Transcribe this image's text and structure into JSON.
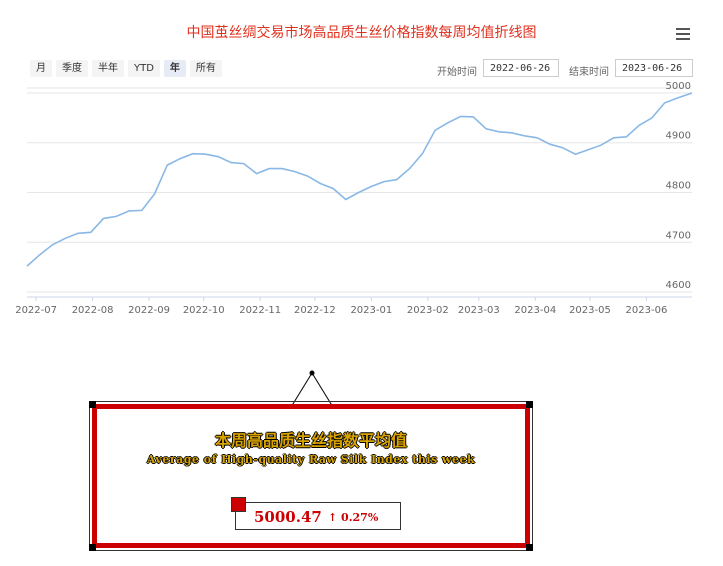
{
  "title": "中国茧丝绸交易市场高品质生丝价格指数每周均值折线图",
  "range_buttons": [
    "月",
    "季度",
    "半年",
    "YTD",
    "年",
    "所有"
  ],
  "active_range": "年",
  "start_label": "开始时间",
  "start_value": "2022-06-26",
  "end_label": "结束时间",
  "end_value": "2023-06-26",
  "summary": {
    "title": "本周高品质生丝指数平均值",
    "subtitle": "Average of High-quality Raw Silk Index this week",
    "value": "5000.47",
    "change": "↑ 0.27%"
  },
  "colors": {
    "line": "#8ab8e6",
    "accent": "#cc0000",
    "title": "#e0301e"
  },
  "chart_data": {
    "type": "line",
    "title": "中国茧丝绸交易市场高品质生丝价格指数每周均值折线图",
    "xlabel": "",
    "ylabel": "",
    "x_ticks": [
      "2022-07",
      "2022-08",
      "2022-09",
      "2022-10",
      "2022-11",
      "2022-12",
      "2023-01",
      "2023-02",
      "2023-03",
      "2023-04",
      "2023-05",
      "2023-06"
    ],
    "y_ticks": [
      4600,
      4700,
      4800,
      4900,
      5000
    ],
    "ylim": [
      4590,
      5010
    ],
    "xlim": [
      "2022-06-26",
      "2023-06-26"
    ],
    "grid": true,
    "series": [
      {
        "x": [
          "2022-06-26",
          "2022-07-03",
          "2022-07-10",
          "2022-07-17",
          "2022-07-24",
          "2022-07-31",
          "2022-08-07",
          "2022-08-14",
          "2022-08-21",
          "2022-08-28",
          "2022-09-04",
          "2022-09-11",
          "2022-09-18",
          "2022-09-25",
          "2022-10-02",
          "2022-10-09",
          "2022-10-16",
          "2022-10-23",
          "2022-10-30",
          "2022-11-06",
          "2022-11-13",
          "2022-11-20",
          "2022-11-27",
          "2022-12-04",
          "2022-12-11",
          "2022-12-18",
          "2022-12-25",
          "2023-01-01",
          "2023-01-08",
          "2023-01-15",
          "2023-01-22",
          "2023-01-29",
          "2023-02-05",
          "2023-02-12",
          "2023-02-19",
          "2023-02-26",
          "2023-03-05",
          "2023-03-12",
          "2023-03-19",
          "2023-03-26",
          "2023-04-02",
          "2023-04-09",
          "2023-04-16",
          "2023-04-23",
          "2023-04-30",
          "2023-05-07",
          "2023-05-14",
          "2023-05-21",
          "2023-05-28",
          "2023-06-04",
          "2023-06-11",
          "2023-06-18",
          "2023-06-26"
        ],
        "y": [
          4652,
          4675,
          4695,
          4708,
          4718,
          4720,
          4748,
          4752,
          4763,
          4764,
          4797,
          4855,
          4868,
          4878,
          4877,
          4872,
          4860,
          4858,
          4838,
          4848,
          4848,
          4842,
          4833,
          4818,
          4808,
          4786,
          4800,
          4812,
          4822,
          4826,
          4848,
          4878,
          4925,
          4940,
          4953,
          4952,
          4928,
          4922,
          4920,
          4914,
          4910,
          4897,
          4890,
          4877,
          4886,
          4895,
          4910,
          4912,
          4935,
          4950,
          4980,
          4990,
          5000
        ]
      }
    ]
  }
}
